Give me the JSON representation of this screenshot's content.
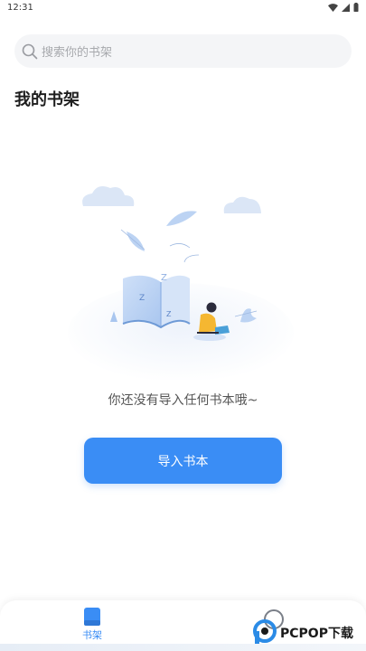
{
  "status_bar": {
    "time": "12:31"
  },
  "search": {
    "placeholder": "搜索你的书架"
  },
  "page": {
    "title": "我的书架"
  },
  "empty_state": {
    "message": "你还没有导入任何书本哦~"
  },
  "actions": {
    "import_label": "导入书本"
  },
  "bottom_nav": {
    "bookshelf_label": "书架"
  },
  "watermark": {
    "text": "PCPOP下载"
  },
  "colors": {
    "accent": "#3a8df5",
    "background": "#ffffff",
    "search_bg": "#f4f5f7"
  },
  "icons": [
    "wifi-icon",
    "signal-icon",
    "battery-icon",
    "search-icon",
    "book-icon",
    "discover-icon"
  ]
}
